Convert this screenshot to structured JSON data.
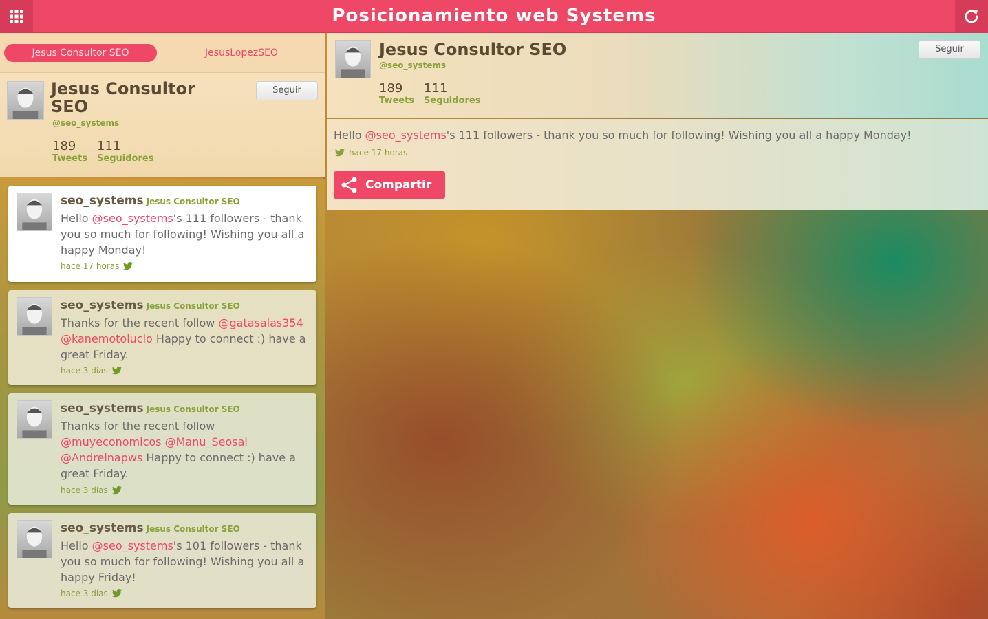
{
  "header": {
    "title": "Posicionamiento web Systems",
    "menu_icon": "grid-icon",
    "refresh_icon": "refresh-icon"
  },
  "tabs": [
    {
      "label": "Jesus Consultor SEO",
      "active": true
    },
    {
      "label": "JesusLopezSEO",
      "active": false
    }
  ],
  "profile": {
    "name": "Jesus Consultor SEO",
    "handle": "@seo_systems",
    "tweets_count": "189",
    "tweets_label": "Tweets",
    "followers_count": "111",
    "followers_label": "Seguidores",
    "follow_label": "Seguir"
  },
  "tweets": [
    {
      "user": "seo_systems",
      "fullname": "Jesus Consultor SEO",
      "parts": [
        {
          "t": "Hello ",
          "m": false
        },
        {
          "t": "@seo_systems",
          "m": true
        },
        {
          "t": "'s 111 followers - thank you so much for following! Wishing you all a happy Monday!",
          "m": false
        }
      ],
      "time": "hace 17 horas"
    },
    {
      "user": "seo_systems",
      "fullname": "Jesus Consultor SEO",
      "parts": [
        {
          "t": "Thanks for the recent follow ",
          "m": false
        },
        {
          "t": "@gatasalas354",
          "m": true
        },
        {
          "t": " ",
          "m": false
        },
        {
          "t": "@kanemotolucio",
          "m": true
        },
        {
          "t": " Happy to connect :) have a great Friday.",
          "m": false
        }
      ],
      "time": "hace 3 días"
    },
    {
      "user": "seo_systems",
      "fullname": "Jesus Consultor SEO",
      "parts": [
        {
          "t": "Thanks for the recent follow ",
          "m": false
        },
        {
          "t": "@muyeconomicos",
          "m": true
        },
        {
          "t": " ",
          "m": false
        },
        {
          "t": "@Manu_Seosal",
          "m": true
        },
        {
          "t": " ",
          "m": false
        },
        {
          "t": "@Andreinapws",
          "m": true
        },
        {
          "t": " Happy to connect :) have a great Friday.",
          "m": false
        }
      ],
      "time": "hace 3 días"
    },
    {
      "user": "seo_systems",
      "fullname": "Jesus Consultor SEO",
      "parts": [
        {
          "t": "Hello ",
          "m": false
        },
        {
          "t": "@seo_systems",
          "m": true
        },
        {
          "t": "'s 101 followers - thank you so much for following! Wishing you all a happy Friday!",
          "m": false
        }
      ],
      "time": "hace 3 días"
    }
  ],
  "detail": {
    "parts": [
      {
        "t": "Hello ",
        "m": false
      },
      {
        "t": "@seo_systems",
        "m": true
      },
      {
        "t": "'s 111 followers - thank you so much for following! Wishing you all a happy Monday!",
        "m": false
      }
    ],
    "time": "hace 17 horas",
    "share_label": "Compartir",
    "share_icon": "share-icon"
  },
  "colors": {
    "accent": "#ee4866",
    "handle_green": "#8aa23a"
  }
}
